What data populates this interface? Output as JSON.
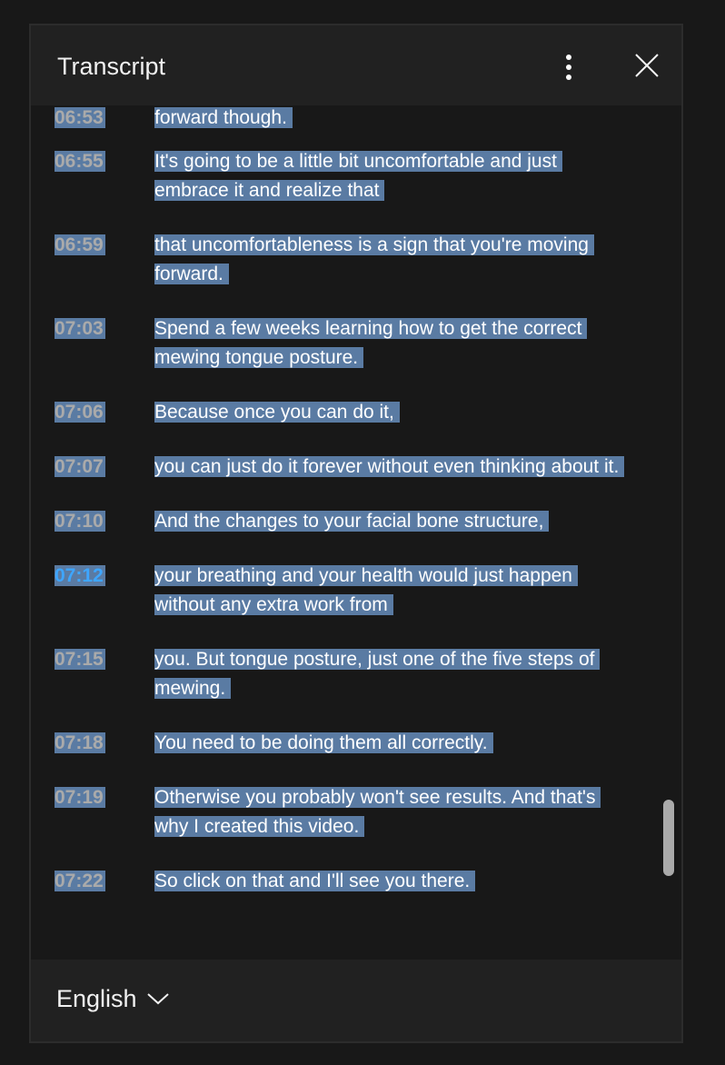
{
  "panel": {
    "title": "Transcript",
    "more_icon": "more-vert-icon",
    "close_icon": "close-icon"
  },
  "segments": [
    {
      "time": "06:53",
      "text": "forward though.",
      "active": false
    },
    {
      "time": "06:55",
      "text": "It's going to be a little bit uncomfortable and just embrace it and realize that",
      "active": false
    },
    {
      "time": "06:59",
      "text": "that uncomfortableness is a sign that you're moving forward.",
      "active": false
    },
    {
      "time": "07:03",
      "text": "Spend a few weeks learning how to get the correct mewing tongue posture.",
      "active": false
    },
    {
      "time": "07:06",
      "text": "Because once you can do it,",
      "active": false
    },
    {
      "time": "07:07",
      "text": "you can just do it forever without even thinking about it.",
      "active": false
    },
    {
      "time": "07:10",
      "text": "And the changes to your facial bone structure,",
      "active": false
    },
    {
      "time": "07:12",
      "text": "your breathing and your health would just happen without any extra work from",
      "active": true
    },
    {
      "time": "07:15",
      "text": "you. But tongue posture, just one of the five steps of mewing.",
      "active": false
    },
    {
      "time": "07:18",
      "text": "You need to be doing them all correctly.",
      "active": false
    },
    {
      "time": "07:19",
      "text": "Otherwise you probably won't see results. And that's why I created this video.",
      "active": false
    },
    {
      "time": "07:22",
      "text": "So click on that and I'll see you there.",
      "active": false
    }
  ],
  "footer": {
    "language": "English",
    "chevron_icon": "chevron-down-icon"
  },
  "colors": {
    "selection": "#5a7ba3",
    "active_timestamp": "#3ea6ff",
    "timestamp": "#aaaaaa"
  }
}
